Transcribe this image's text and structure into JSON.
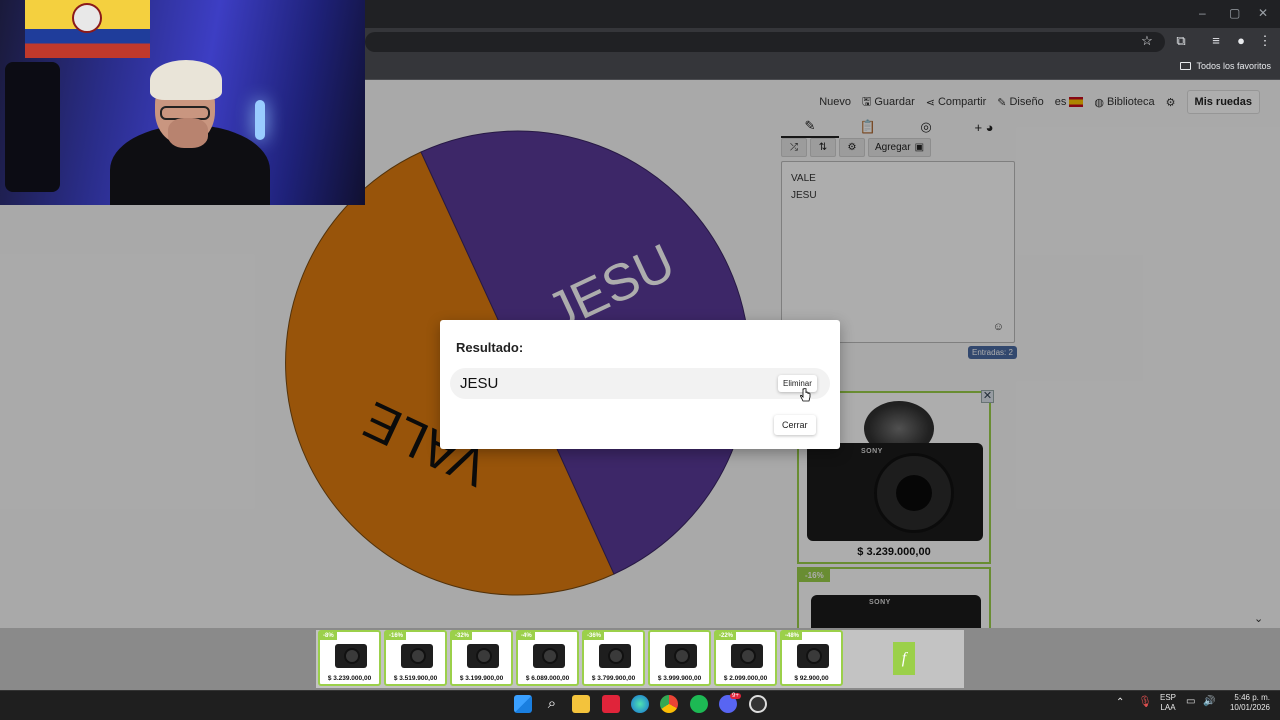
{
  "browser": {
    "bookmarks_all": "Todos los favoritos"
  },
  "nav": {
    "items": [
      "Nuevo",
      "Guardar",
      "Compartir",
      "Diseño",
      "es",
      "Biblioteca"
    ],
    "mis_ruedas": "Mis ruedas"
  },
  "editor": {
    "add_label": "Agregar",
    "entries": [
      "VALE",
      "JESU"
    ],
    "count": "Entradas: 2"
  },
  "wheel": {
    "segments": [
      {
        "label": "VALE",
        "color": "#e07d10"
      },
      {
        "label": "JESU",
        "color": "#5b3a9a"
      }
    ]
  },
  "dialog": {
    "title": "Resultado:",
    "result": "JESU",
    "remove_label": "Eliminar",
    "close_label": "Cerrar"
  },
  "ads": {
    "cards": [
      {
        "price": "$ 3.239.000,00",
        "brand": "SONY"
      },
      {
        "discount": "-16%",
        "brand": "SONY"
      }
    ],
    "strip": [
      {
        "discount": "-8%",
        "price": "$ 3.239.000,00"
      },
      {
        "discount": "-16%",
        "price": "$ 3.519.900,00"
      },
      {
        "discount": "-32%",
        "price": "$ 3.199.900,00"
      },
      {
        "discount": "-4%",
        "price": "$ 6.089.000,00"
      },
      {
        "discount": "-36%",
        "price": "$ 3.799.900,00"
      },
      {
        "discount": "",
        "price": "$ 3.999.900,00"
      },
      {
        "discount": "-22%",
        "price": "$ 2.099.000,00"
      },
      {
        "discount": "-48%",
        "price": "$ 92.900,00"
      }
    ]
  },
  "taskbar": {
    "lang": "ESP",
    "lang2": "LAA",
    "time": "5:46 p. m.",
    "date": "10/01/2026",
    "discord_badge": "9+"
  }
}
